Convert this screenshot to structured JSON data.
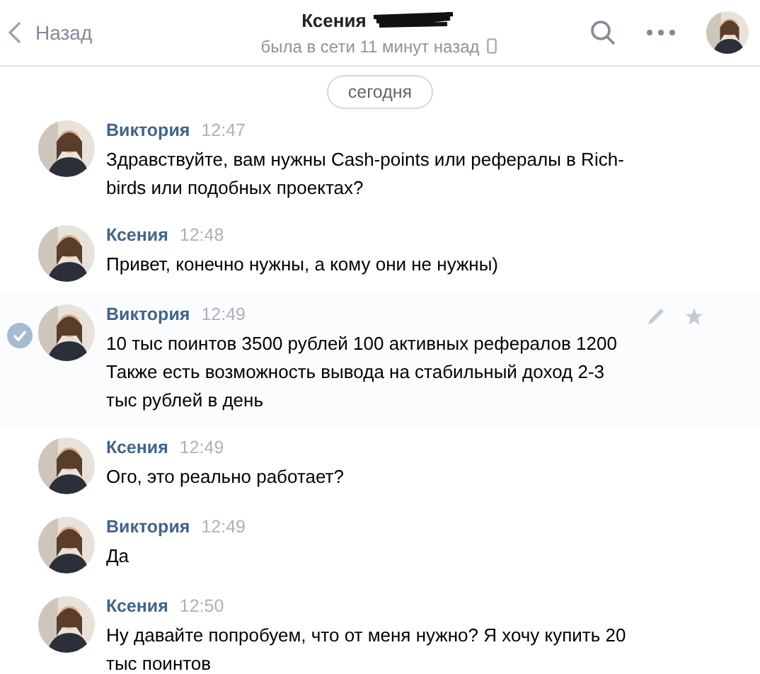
{
  "header": {
    "back": "Назад",
    "title": "Ксения",
    "status": "была в сети 11 минут назад"
  },
  "date_pill": "сегодня",
  "messages": [
    {
      "author": "Виктория",
      "time": "12:47",
      "text": "Здравствуйте, вам нужны Cash-points или рефералы в Rich-birds или подобных проектах?",
      "selected": false
    },
    {
      "author": "Ксения",
      "time": "12:48",
      "text": "Привет, конечно нужны, а кому они не нужны)",
      "selected": false
    },
    {
      "author": "Виктория",
      "time": "12:49",
      "text": "10 тыс поинтов 3500 рублей 100 активных рефералов 1200 Также есть возможность вывода на стабильный доход 2-3 тыс рублей в день",
      "selected": true
    },
    {
      "author": "Ксения",
      "time": "12:49",
      "text": "Ого, это реально работает?",
      "selected": false
    },
    {
      "author": "Виктория",
      "time": "12:49",
      "text": "Да",
      "selected": false
    },
    {
      "author": "Ксения",
      "time": "12:50",
      "text": "Ну давайте попробуем, что от меня нужно? Я хочу купить 20 тыс поинтов",
      "selected": false
    }
  ]
}
